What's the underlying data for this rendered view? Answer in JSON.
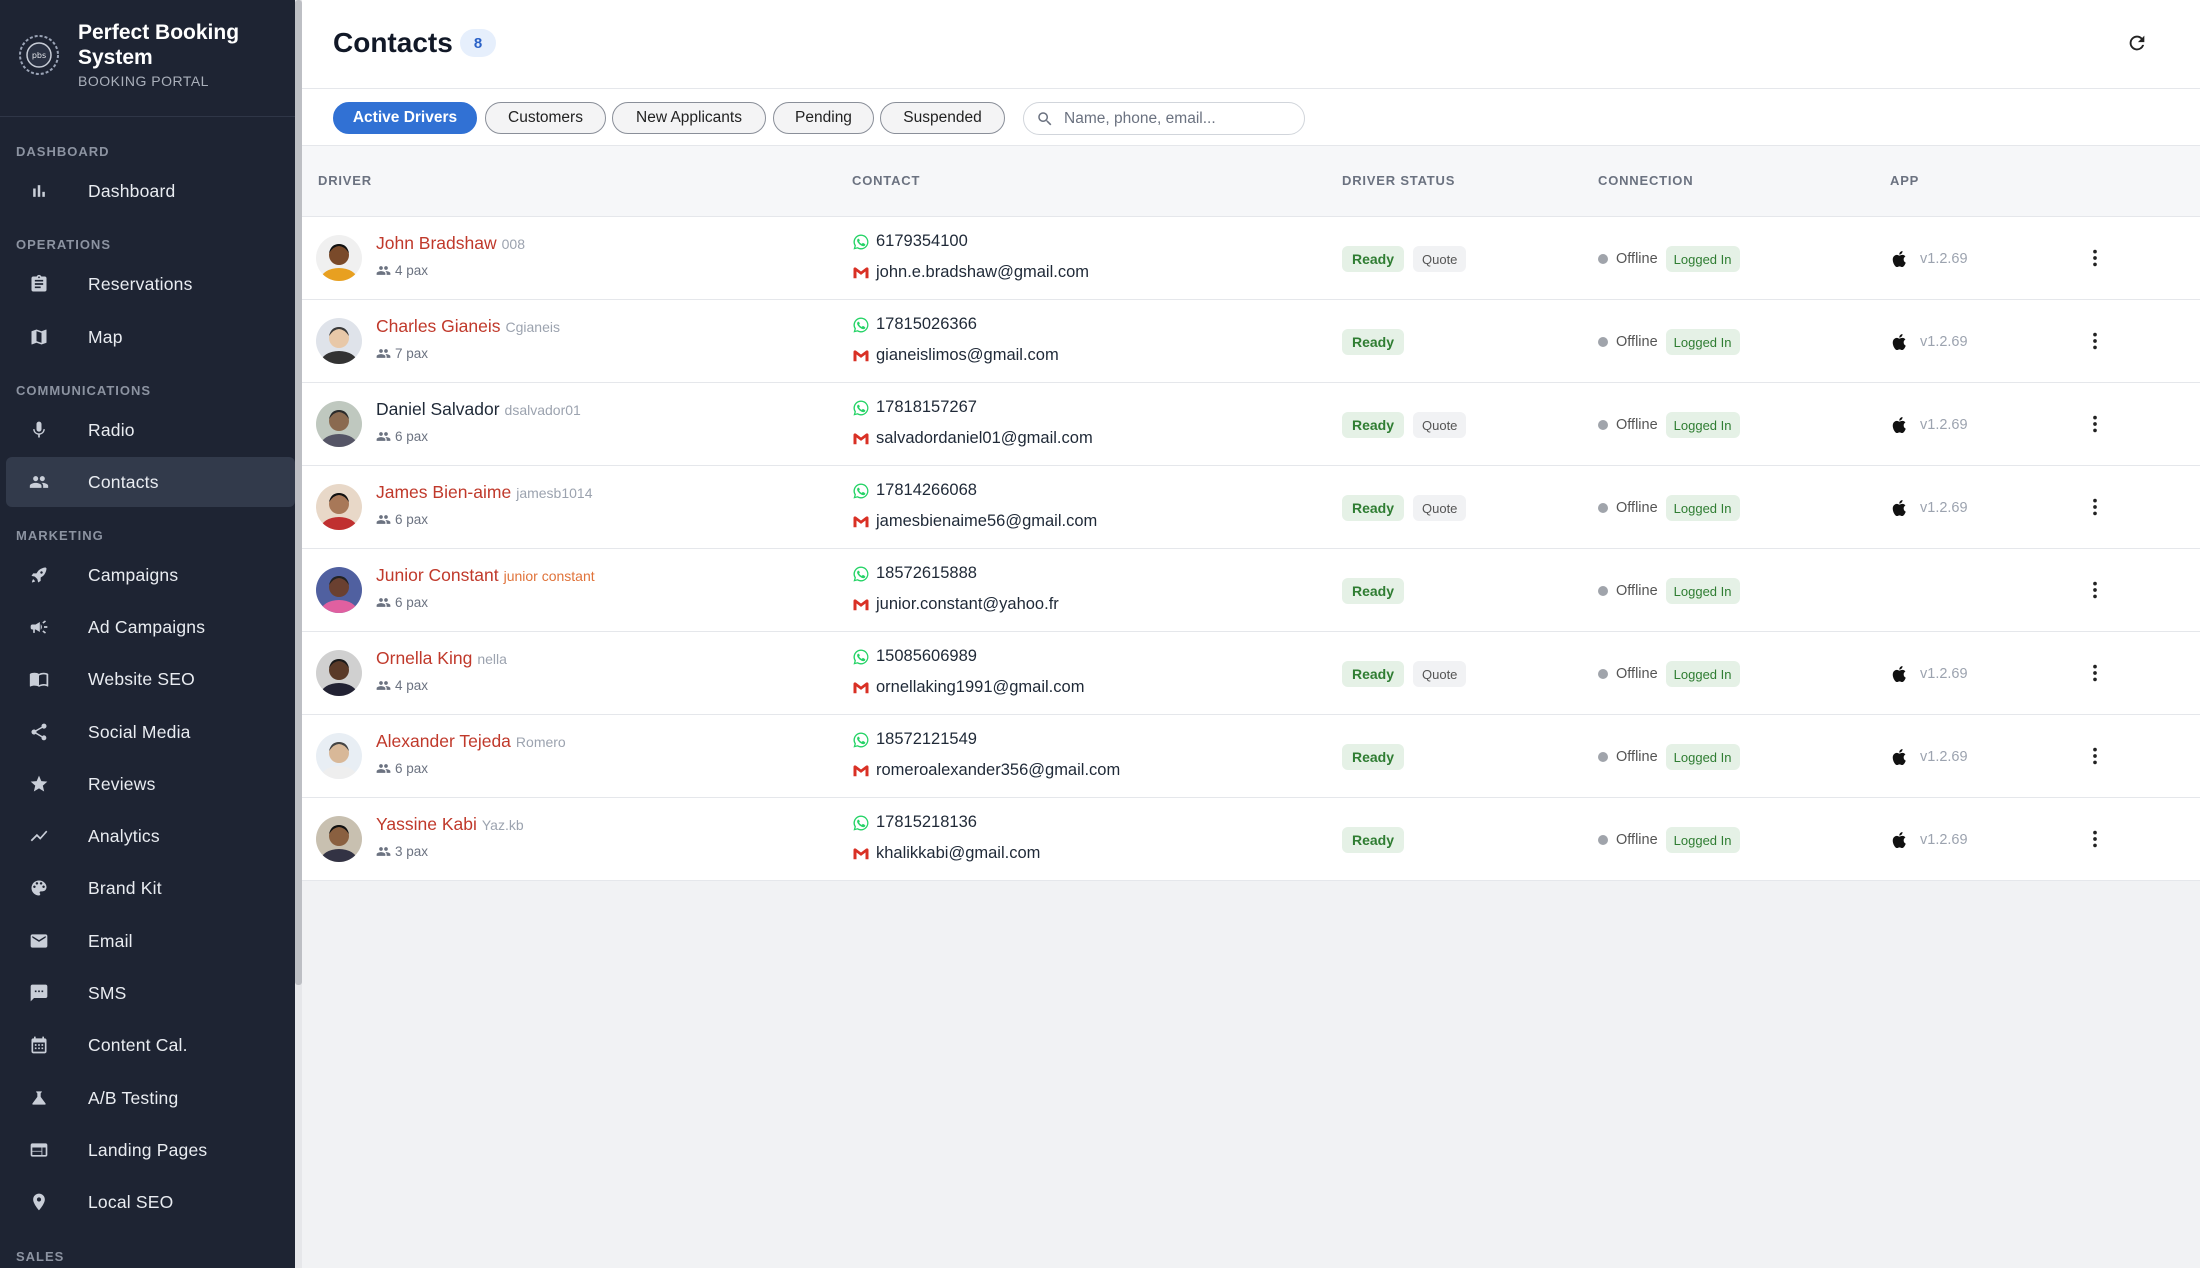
{
  "brand": {
    "title": "Perfect Booking System",
    "subtitle": "BOOKING PORTAL"
  },
  "sidebar": {
    "sections": {
      "dashboard": "DASHBOARD",
      "operations": "OPERATIONS",
      "communications": "COMMUNICATIONS",
      "marketing": "MARKETING",
      "sales": "SALES"
    },
    "items": {
      "dashboard": "Dashboard",
      "reservations": "Reservations",
      "map": "Map",
      "radio": "Radio",
      "contacts": "Contacts",
      "campaigns": "Campaigns",
      "ad_campaigns": "Ad Campaigns",
      "website_seo": "Website SEO",
      "social_media": "Social Media",
      "reviews": "Reviews",
      "analytics": "Analytics",
      "brand_kit": "Brand Kit",
      "email": "Email",
      "sms": "SMS",
      "content_cal": "Content Cal.",
      "ab_testing": "A/B Testing",
      "landing_pages": "Landing Pages",
      "local_seo": "Local SEO"
    }
  },
  "header": {
    "title": "Contacts",
    "count": "8"
  },
  "filters": {
    "active_drivers": "Active Drivers",
    "customers": "Customers",
    "new_applicants": "New Applicants",
    "pending": "Pending",
    "suspended": "Suspended"
  },
  "search": {
    "placeholder": "Name, phone, email...",
    "value": ""
  },
  "table": {
    "headers": {
      "driver": "DRIVER",
      "contact": "CONTACT",
      "driver_status": "DRIVER STATUS",
      "connection": "CONNECTION",
      "app": "APP"
    },
    "rows": [
      {
        "name": "John Bradshaw",
        "handle": "008",
        "pax": "4 pax",
        "phone": "6179354100",
        "email": "john.e.bradshaw@gmail.com",
        "status": "Ready",
        "quote": "Quote",
        "connection": "Offline",
        "login": "Logged In",
        "version": "v1.2.69"
      },
      {
        "name": "Charles Gianeis",
        "handle": "Cgianeis",
        "pax": "7 pax",
        "phone": "17815026366",
        "email": "gianeislimos@gmail.com",
        "status": "Ready",
        "quote": "",
        "connection": "Offline",
        "login": "Logged In",
        "version": "v1.2.69"
      },
      {
        "name": "Daniel Salvador",
        "handle": "dsalvador01",
        "pax": "6 pax",
        "phone": "17818157267",
        "email": "salvadordaniel01@gmail.com",
        "status": "Ready",
        "quote": "Quote",
        "connection": "Offline",
        "login": "Logged In",
        "version": "v1.2.69"
      },
      {
        "name": "James Bien-aime",
        "handle": "jamesb1014",
        "pax": "6 pax",
        "phone": "17814266068",
        "email": "jamesbienaime56@gmail.com",
        "status": "Ready",
        "quote": "Quote",
        "connection": "Offline",
        "login": "Logged In",
        "version": "v1.2.69"
      },
      {
        "name": "Junior Constant",
        "handle": "junior constant",
        "pax": "6 pax",
        "phone": "18572615888",
        "email": "junior.constant@yahoo.fr",
        "status": "Ready",
        "quote": "",
        "connection": "Offline",
        "login": "Logged In",
        "version": ""
      },
      {
        "name": "Ornella King",
        "handle": "nella",
        "pax": "4 pax",
        "phone": "15085606989",
        "email": "ornellaking1991@gmail.com",
        "status": "Ready",
        "quote": "Quote",
        "connection": "Offline",
        "login": "Logged In",
        "version": "v1.2.69"
      },
      {
        "name": "Alexander Tejeda",
        "handle": "Romero",
        "pax": "6 pax",
        "phone": "18572121549",
        "email": "romeroalexander356@gmail.com",
        "status": "Ready",
        "quote": "",
        "connection": "Offline",
        "login": "Logged In",
        "version": "v1.2.69"
      },
      {
        "name": "Yassine Kabi",
        "handle": "Yaz.kb",
        "pax": "3 pax",
        "phone": "17815218136",
        "email": "khalikkabi@gmail.com",
        "status": "Ready",
        "quote": "",
        "connection": "Offline",
        "login": "Logged In",
        "version": "v1.2.69"
      }
    ]
  },
  "icons": {
    "sidebar": [
      "bar-chart-icon",
      "clipboard-icon",
      "map-icon",
      "microphone-icon",
      "people-icon",
      "rocket-icon",
      "megaphone-icon",
      "book-icon",
      "share-icon",
      "star-icon",
      "trending-icon",
      "palette-icon",
      "mail-icon",
      "chat-icon",
      "calendar-icon",
      "flask-icon",
      "web-page-icon",
      "location-pin-icon"
    ],
    "header": [
      "refresh-icon",
      "search-icon"
    ],
    "row": [
      "whatsapp-icon",
      "gmail-icon",
      "apple-icon",
      "more-vert-icon",
      "people-icon"
    ]
  },
  "colors": {
    "accent": "#3171d4",
    "sidebar_bg": "#1e2433",
    "name_red": "#c0392b",
    "ready_green": "#2f7d32",
    "whatsapp": "#25d366",
    "gmail": "#d93025"
  }
}
